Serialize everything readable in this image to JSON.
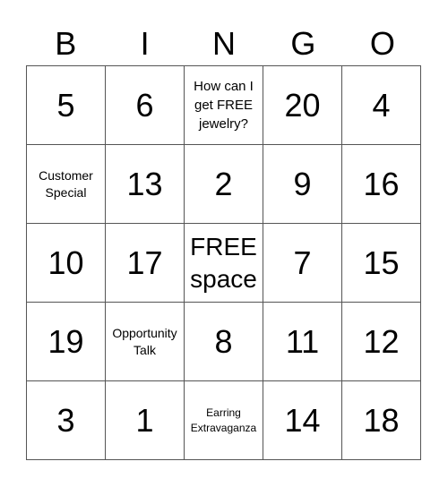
{
  "title_letters": [
    "B",
    "I",
    "N",
    "G",
    "O"
  ],
  "cells": [
    [
      {
        "text": "5",
        "kind": "num"
      },
      {
        "text": "6",
        "kind": "num"
      },
      {
        "text": "How can I get FREE jewelry?",
        "kind": "txt-m"
      },
      {
        "text": "20",
        "kind": "num"
      },
      {
        "text": "4",
        "kind": "num"
      }
    ],
    [
      {
        "text": "Customer Special",
        "kind": "txt-s"
      },
      {
        "text": "13",
        "kind": "num"
      },
      {
        "text": "2",
        "kind": "num"
      },
      {
        "text": "9",
        "kind": "num"
      },
      {
        "text": "16",
        "kind": "num"
      }
    ],
    [
      {
        "text": "10",
        "kind": "num"
      },
      {
        "text": "17",
        "kind": "num"
      },
      {
        "text": "FREE space",
        "kind": "free"
      },
      {
        "text": "7",
        "kind": "num"
      },
      {
        "text": "15",
        "kind": "num"
      }
    ],
    [
      {
        "text": "19",
        "kind": "num"
      },
      {
        "text": "Opportunity Talk",
        "kind": "txt-s"
      },
      {
        "text": "8",
        "kind": "num"
      },
      {
        "text": "11",
        "kind": "num"
      },
      {
        "text": "12",
        "kind": "num"
      }
    ],
    [
      {
        "text": "3",
        "kind": "num"
      },
      {
        "text": "1",
        "kind": "num"
      },
      {
        "text": "Earring Extravaganza",
        "kind": "txt-xs"
      },
      {
        "text": "14",
        "kind": "num"
      },
      {
        "text": "18",
        "kind": "num"
      }
    ]
  ]
}
